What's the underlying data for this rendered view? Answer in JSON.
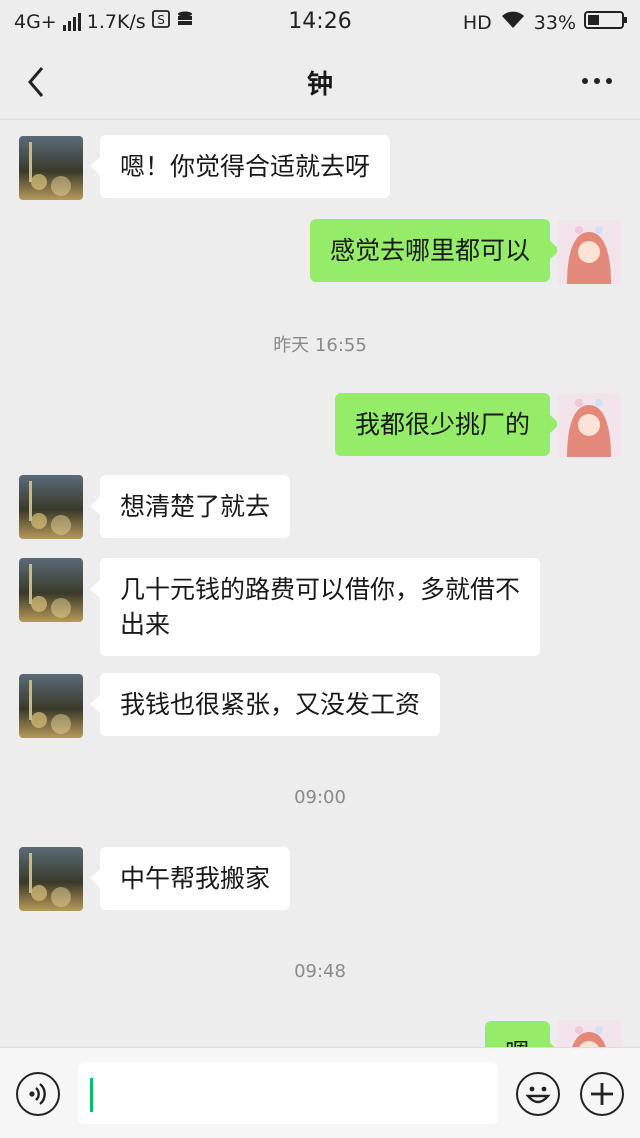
{
  "status_bar": {
    "network": "4G+",
    "speed": "1.7K/s",
    "time": "14:26",
    "hd": "HD",
    "battery": "33%",
    "battery_level": 0.33,
    "icons": [
      "signal-icon",
      "sim-s-icon",
      "storage-icon",
      "wifi-icon",
      "battery-icon"
    ]
  },
  "nav": {
    "title": "钟",
    "back_icon": "chevron-left-icon",
    "more_icon": "more-dots-icon"
  },
  "messages": [
    {
      "side": "left",
      "text": "嗯！你觉得合适就去呀"
    },
    {
      "side": "right",
      "text": "感觉去哪里都可以"
    },
    {
      "type": "time",
      "text": "昨天 16:55"
    },
    {
      "side": "right",
      "text": "我都很少挑厂的"
    },
    {
      "side": "left",
      "text": "想清楚了就去"
    },
    {
      "side": "left",
      "text": "几十元钱的路费可以借你，多就借不出来"
    },
    {
      "side": "left",
      "text": "我钱也很紧张，又没发工资"
    },
    {
      "type": "time",
      "text": "09:00"
    },
    {
      "side": "left",
      "text": "中午帮我搬家"
    },
    {
      "type": "time",
      "text": "09:48"
    },
    {
      "side": "right",
      "text": "嗯"
    }
  ],
  "input_bar": {
    "text": "",
    "icons": [
      "voice-icon",
      "emoji-icon",
      "plus-icon"
    ]
  },
  "colors": {
    "background": "#ededed",
    "bubble_self": "#95ec69",
    "bubble_other": "#ffffff",
    "caret": "#07c160"
  }
}
